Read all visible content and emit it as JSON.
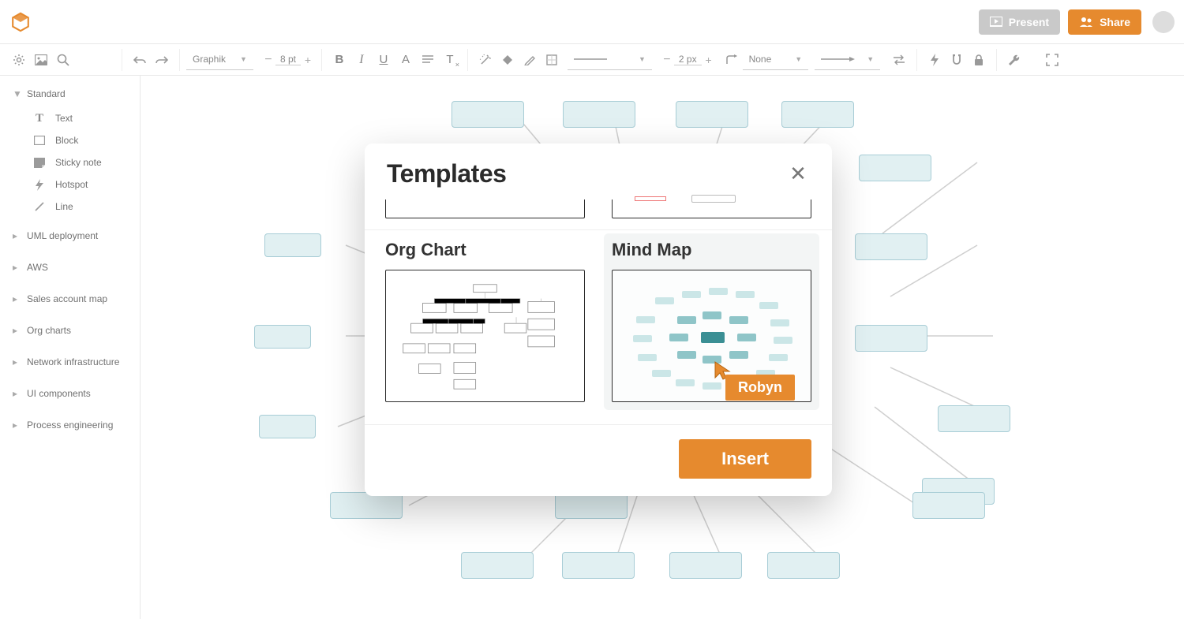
{
  "header": {
    "present_label": "Present",
    "share_label": "Share"
  },
  "toolbar": {
    "font_family": "Graphik",
    "font_size": "8 pt",
    "stroke_width": "2 px",
    "arrow_style": "None"
  },
  "sidebar": {
    "standard_label": "Standard",
    "standard_items": [
      {
        "icon": "text",
        "label": "Text"
      },
      {
        "icon": "block",
        "label": "Block"
      },
      {
        "icon": "sticky",
        "label": "Sticky note"
      },
      {
        "icon": "hotspot",
        "label": "Hotspot"
      },
      {
        "icon": "line",
        "label": "Line"
      }
    ],
    "groups": [
      "UML deployment",
      "AWS",
      "Sales account map",
      "Org charts",
      "Network infrastructure",
      "UI components",
      "Process engineering"
    ]
  },
  "modal": {
    "title": "Templates",
    "template_a": "Org Chart",
    "template_b": "Mind Map",
    "insert_label": "Insert",
    "cursor_user": "Robyn"
  }
}
